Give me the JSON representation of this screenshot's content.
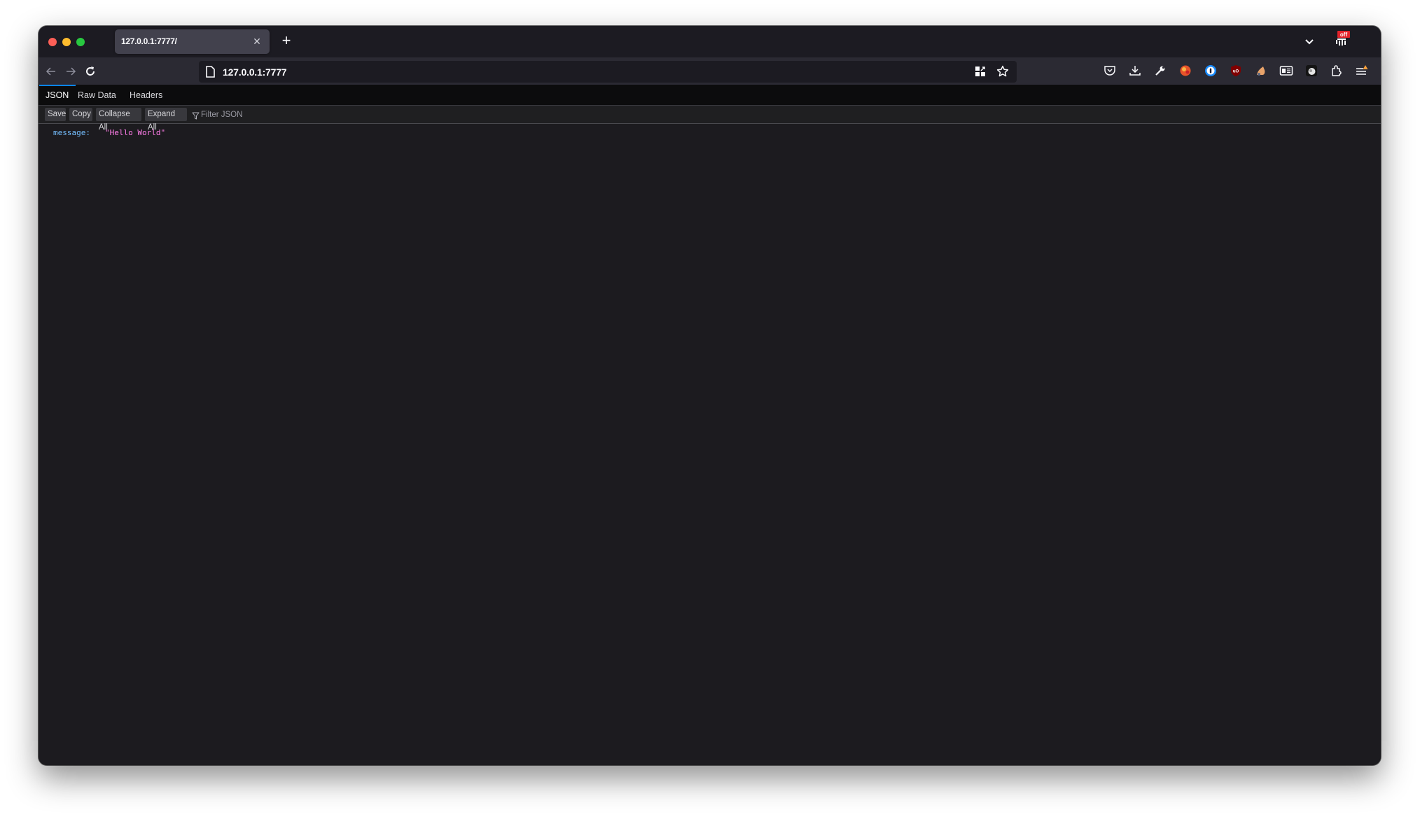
{
  "browser": {
    "tab": {
      "title": "127.0.0.1:7777/",
      "close_icon": "close-icon"
    },
    "new_tab_label": "+",
    "url": "127.0.0.1:7777",
    "extension_badge": "off",
    "toolbar_icons": [
      "pocket-icon",
      "download-icon",
      "wrench-icon",
      "fox-extension-icon",
      "1password-icon",
      "ublock-origin-icon",
      "cat-extension-icon",
      "reader-icon",
      "dark-reader-icon",
      "extensions-puzzle-icon",
      "menu-icon"
    ]
  },
  "viewer": {
    "tabs": [
      {
        "label": "JSON",
        "selected": true
      },
      {
        "label": "Raw Data",
        "selected": false
      },
      {
        "label": "Headers",
        "selected": false
      }
    ],
    "toolbar": {
      "save": "Save",
      "copy": "Copy",
      "collapse_all": "Collapse All",
      "expand_all": "Expand All",
      "filter_placeholder": "Filter JSON",
      "filter_value": ""
    },
    "rows": [
      {
        "key": "message:",
        "value": "\"Hello World\""
      }
    ]
  }
}
